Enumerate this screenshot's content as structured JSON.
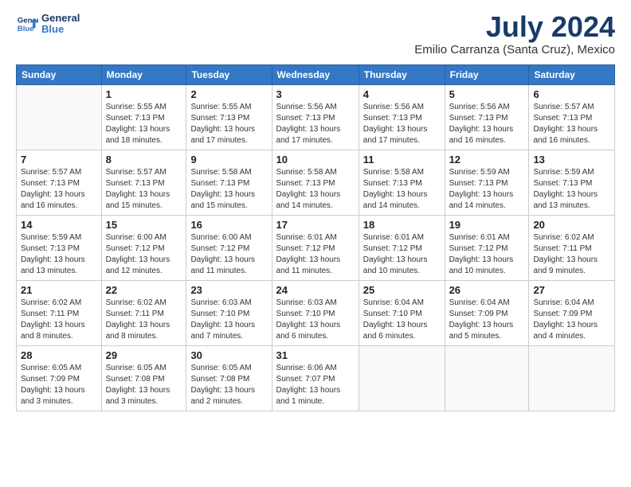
{
  "header": {
    "logo_line1": "General",
    "logo_line2": "Blue",
    "month": "July 2024",
    "location": "Emilio Carranza (Santa Cruz), Mexico"
  },
  "weekdays": [
    "Sunday",
    "Monday",
    "Tuesday",
    "Wednesday",
    "Thursday",
    "Friday",
    "Saturday"
  ],
  "weeks": [
    [
      {
        "day": "",
        "info": ""
      },
      {
        "day": "1",
        "info": "Sunrise: 5:55 AM\nSunset: 7:13 PM\nDaylight: 13 hours\nand 18 minutes."
      },
      {
        "day": "2",
        "info": "Sunrise: 5:55 AM\nSunset: 7:13 PM\nDaylight: 13 hours\nand 17 minutes."
      },
      {
        "day": "3",
        "info": "Sunrise: 5:56 AM\nSunset: 7:13 PM\nDaylight: 13 hours\nand 17 minutes."
      },
      {
        "day": "4",
        "info": "Sunrise: 5:56 AM\nSunset: 7:13 PM\nDaylight: 13 hours\nand 17 minutes."
      },
      {
        "day": "5",
        "info": "Sunrise: 5:56 AM\nSunset: 7:13 PM\nDaylight: 13 hours\nand 16 minutes."
      },
      {
        "day": "6",
        "info": "Sunrise: 5:57 AM\nSunset: 7:13 PM\nDaylight: 13 hours\nand 16 minutes."
      }
    ],
    [
      {
        "day": "7",
        "info": "Sunrise: 5:57 AM\nSunset: 7:13 PM\nDaylight: 13 hours\nand 16 minutes."
      },
      {
        "day": "8",
        "info": "Sunrise: 5:57 AM\nSunset: 7:13 PM\nDaylight: 13 hours\nand 15 minutes."
      },
      {
        "day": "9",
        "info": "Sunrise: 5:58 AM\nSunset: 7:13 PM\nDaylight: 13 hours\nand 15 minutes."
      },
      {
        "day": "10",
        "info": "Sunrise: 5:58 AM\nSunset: 7:13 PM\nDaylight: 13 hours\nand 14 minutes."
      },
      {
        "day": "11",
        "info": "Sunrise: 5:58 AM\nSunset: 7:13 PM\nDaylight: 13 hours\nand 14 minutes."
      },
      {
        "day": "12",
        "info": "Sunrise: 5:59 AM\nSunset: 7:13 PM\nDaylight: 13 hours\nand 14 minutes."
      },
      {
        "day": "13",
        "info": "Sunrise: 5:59 AM\nSunset: 7:13 PM\nDaylight: 13 hours\nand 13 minutes."
      }
    ],
    [
      {
        "day": "14",
        "info": "Sunrise: 5:59 AM\nSunset: 7:13 PM\nDaylight: 13 hours\nand 13 minutes."
      },
      {
        "day": "15",
        "info": "Sunrise: 6:00 AM\nSunset: 7:12 PM\nDaylight: 13 hours\nand 12 minutes."
      },
      {
        "day": "16",
        "info": "Sunrise: 6:00 AM\nSunset: 7:12 PM\nDaylight: 13 hours\nand 11 minutes."
      },
      {
        "day": "17",
        "info": "Sunrise: 6:01 AM\nSunset: 7:12 PM\nDaylight: 13 hours\nand 11 minutes."
      },
      {
        "day": "18",
        "info": "Sunrise: 6:01 AM\nSunset: 7:12 PM\nDaylight: 13 hours\nand 10 minutes."
      },
      {
        "day": "19",
        "info": "Sunrise: 6:01 AM\nSunset: 7:12 PM\nDaylight: 13 hours\nand 10 minutes."
      },
      {
        "day": "20",
        "info": "Sunrise: 6:02 AM\nSunset: 7:11 PM\nDaylight: 13 hours\nand 9 minutes."
      }
    ],
    [
      {
        "day": "21",
        "info": "Sunrise: 6:02 AM\nSunset: 7:11 PM\nDaylight: 13 hours\nand 8 minutes."
      },
      {
        "day": "22",
        "info": "Sunrise: 6:02 AM\nSunset: 7:11 PM\nDaylight: 13 hours\nand 8 minutes."
      },
      {
        "day": "23",
        "info": "Sunrise: 6:03 AM\nSunset: 7:10 PM\nDaylight: 13 hours\nand 7 minutes."
      },
      {
        "day": "24",
        "info": "Sunrise: 6:03 AM\nSunset: 7:10 PM\nDaylight: 13 hours\nand 6 minutes."
      },
      {
        "day": "25",
        "info": "Sunrise: 6:04 AM\nSunset: 7:10 PM\nDaylight: 13 hours\nand 6 minutes."
      },
      {
        "day": "26",
        "info": "Sunrise: 6:04 AM\nSunset: 7:09 PM\nDaylight: 13 hours\nand 5 minutes."
      },
      {
        "day": "27",
        "info": "Sunrise: 6:04 AM\nSunset: 7:09 PM\nDaylight: 13 hours\nand 4 minutes."
      }
    ],
    [
      {
        "day": "28",
        "info": "Sunrise: 6:05 AM\nSunset: 7:09 PM\nDaylight: 13 hours\nand 3 minutes."
      },
      {
        "day": "29",
        "info": "Sunrise: 6:05 AM\nSunset: 7:08 PM\nDaylight: 13 hours\nand 3 minutes."
      },
      {
        "day": "30",
        "info": "Sunrise: 6:05 AM\nSunset: 7:08 PM\nDaylight: 13 hours\nand 2 minutes."
      },
      {
        "day": "31",
        "info": "Sunrise: 6:06 AM\nSunset: 7:07 PM\nDaylight: 13 hours\nand 1 minute."
      },
      {
        "day": "",
        "info": ""
      },
      {
        "day": "",
        "info": ""
      },
      {
        "day": "",
        "info": ""
      }
    ]
  ]
}
